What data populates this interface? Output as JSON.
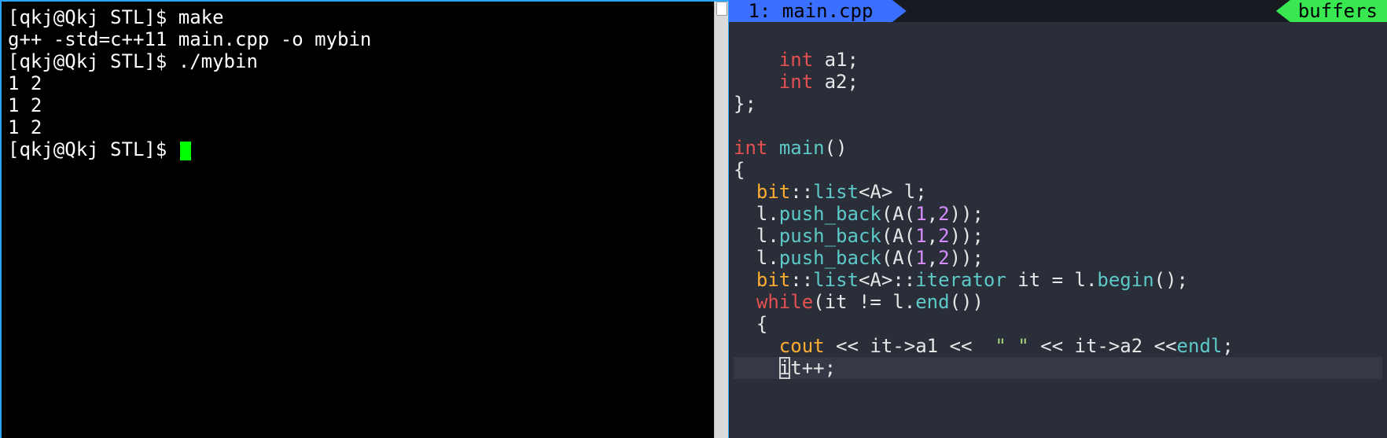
{
  "terminal": {
    "lines": [
      {
        "prompt": "[qkj@Qkj STL]$ ",
        "cmd": "make"
      },
      {
        "text": "g++ -std=c++11 main.cpp -o mybin"
      },
      {
        "prompt": "[qkj@Qkj STL]$ ",
        "cmd": "./mybin"
      },
      {
        "text": "1 2"
      },
      {
        "text": "1 2"
      },
      {
        "text": "1 2"
      },
      {
        "prompt": "[qkj@Qkj STL]$ ",
        "cmd": "",
        "cursor": true
      }
    ]
  },
  "editor": {
    "tab_label": " 1: main.cpp ",
    "buffers_label": "buffers",
    "code": [
      [],
      [
        {
          "t": "    ",
          "c": "c-white"
        },
        {
          "t": "int",
          "c": "c-kw"
        },
        {
          "t": " a1;",
          "c": "c-white"
        }
      ],
      [
        {
          "t": "    ",
          "c": "c-white"
        },
        {
          "t": "int",
          "c": "c-kw"
        },
        {
          "t": " a2;",
          "c": "c-white"
        }
      ],
      [
        {
          "t": "};",
          "c": "c-white"
        }
      ],
      [],
      [
        {
          "t": "int",
          "c": "c-kw"
        },
        {
          "t": " ",
          "c": "c-white"
        },
        {
          "t": "main",
          "c": "c-func"
        },
        {
          "t": "()",
          "c": "c-white"
        }
      ],
      [
        {
          "t": "{",
          "c": "c-white"
        }
      ],
      [
        {
          "t": "  ",
          "c": "c-white"
        },
        {
          "t": "bit",
          "c": "c-type"
        },
        {
          "t": "::",
          "c": "c-white"
        },
        {
          "t": "list",
          "c": "c-func"
        },
        {
          "t": "<A> l;",
          "c": "c-white"
        }
      ],
      [
        {
          "t": "  l.",
          "c": "c-white"
        },
        {
          "t": "push_back",
          "c": "c-func"
        },
        {
          "t": "(",
          "c": "c-white"
        },
        {
          "t": "A",
          "c": "c-white"
        },
        {
          "t": "(",
          "c": "c-white"
        },
        {
          "t": "1",
          "c": "c-num"
        },
        {
          "t": ",",
          "c": "c-white"
        },
        {
          "t": "2",
          "c": "c-num"
        },
        {
          "t": "));",
          "c": "c-white"
        }
      ],
      [
        {
          "t": "  l.",
          "c": "c-white"
        },
        {
          "t": "push_back",
          "c": "c-func"
        },
        {
          "t": "(",
          "c": "c-white"
        },
        {
          "t": "A",
          "c": "c-white"
        },
        {
          "t": "(",
          "c": "c-white"
        },
        {
          "t": "1",
          "c": "c-num"
        },
        {
          "t": ",",
          "c": "c-white"
        },
        {
          "t": "2",
          "c": "c-num"
        },
        {
          "t": "));",
          "c": "c-white"
        }
      ],
      [
        {
          "t": "  l.",
          "c": "c-white"
        },
        {
          "t": "push_back",
          "c": "c-func"
        },
        {
          "t": "(",
          "c": "c-white"
        },
        {
          "t": "A",
          "c": "c-white"
        },
        {
          "t": "(",
          "c": "c-white"
        },
        {
          "t": "1",
          "c": "c-num"
        },
        {
          "t": ",",
          "c": "c-white"
        },
        {
          "t": "2",
          "c": "c-num"
        },
        {
          "t": "));",
          "c": "c-white"
        }
      ],
      [
        {
          "t": "  ",
          "c": "c-white"
        },
        {
          "t": "bit",
          "c": "c-type"
        },
        {
          "t": "::",
          "c": "c-white"
        },
        {
          "t": "list",
          "c": "c-func"
        },
        {
          "t": "<A>::",
          "c": "c-white"
        },
        {
          "t": "iterator",
          "c": "c-func"
        },
        {
          "t": " it = l.",
          "c": "c-white"
        },
        {
          "t": "begin",
          "c": "c-func"
        },
        {
          "t": "();",
          "c": "c-white"
        }
      ],
      [
        {
          "t": "  ",
          "c": "c-white"
        },
        {
          "t": "while",
          "c": "c-kw"
        },
        {
          "t": "(it != l.",
          "c": "c-white"
        },
        {
          "t": "end",
          "c": "c-func"
        },
        {
          "t": "())",
          "c": "c-white"
        }
      ],
      [
        {
          "t": "  {",
          "c": "c-white"
        }
      ],
      [
        {
          "t": "    ",
          "c": "c-white"
        },
        {
          "t": "cout",
          "c": "c-type"
        },
        {
          "t": " << it->a1 <<  ",
          "c": "c-white"
        },
        {
          "t": "\" \"",
          "c": "c-str"
        },
        {
          "t": " << it->a2 <<",
          "c": "c-white"
        },
        {
          "t": "endl",
          "c": "c-func"
        },
        {
          "t": ";",
          "c": "c-white"
        }
      ],
      [
        {
          "t": "    ",
          "c": "c-white"
        },
        {
          "t": "i",
          "c": "c-white",
          "cursor": true
        },
        {
          "t": "t++;",
          "c": "c-white"
        }
      ]
    ]
  }
}
